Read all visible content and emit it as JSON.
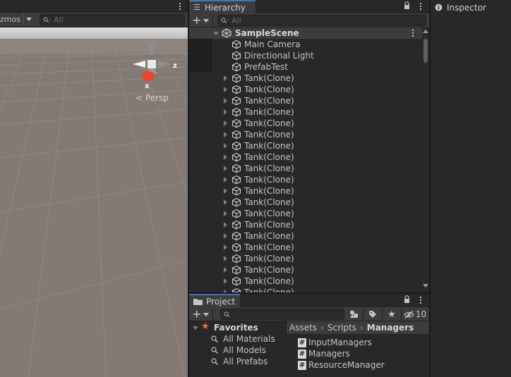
{
  "scene": {
    "toolbar": {
      "gizmos_label": "zmos",
      "search_placeholder": "All"
    },
    "viewport": {
      "persp_label": "Persp",
      "gizmo_axis_x": "x",
      "gizmo_axis_z": "z"
    }
  },
  "hierarchy": {
    "tab_label": "Hierarchy",
    "search_placeholder": "All",
    "scene_name": "SampleScene",
    "items": [
      {
        "label": "Main Camera",
        "has_children": false
      },
      {
        "label": "Directional Light",
        "has_children": false
      },
      {
        "label": "PrefabTest",
        "has_children": false
      },
      {
        "label": "Tank(Clone)",
        "has_children": true
      },
      {
        "label": "Tank(Clone)",
        "has_children": true
      },
      {
        "label": "Tank(Clone)",
        "has_children": true
      },
      {
        "label": "Tank(Clone)",
        "has_children": true
      },
      {
        "label": "Tank(Clone)",
        "has_children": true
      },
      {
        "label": "Tank(Clone)",
        "has_children": true
      },
      {
        "label": "Tank(Clone)",
        "has_children": true
      },
      {
        "label": "Tank(Clone)",
        "has_children": true
      },
      {
        "label": "Tank(Clone)",
        "has_children": true
      },
      {
        "label": "Tank(Clone)",
        "has_children": true
      },
      {
        "label": "Tank(Clone)",
        "has_children": true
      },
      {
        "label": "Tank(Clone)",
        "has_children": true
      },
      {
        "label": "Tank(Clone)",
        "has_children": true
      },
      {
        "label": "Tank(Clone)",
        "has_children": true
      },
      {
        "label": "Tank(Clone)",
        "has_children": true
      },
      {
        "label": "Tank(Clone)",
        "has_children": true
      },
      {
        "label": "Tank(Clone)",
        "has_children": true
      },
      {
        "label": "Tank(Clone)",
        "has_children": true
      },
      {
        "label": "Tank(Clone)",
        "has_children": true
      },
      {
        "label": "Tank(Clone)",
        "has_children": true
      }
    ]
  },
  "project": {
    "tab_label": "Project",
    "hidden_count": "10",
    "favorites": {
      "label": "Favorites",
      "items": [
        "All Materials",
        "All Models",
        "All Prefabs"
      ]
    },
    "breadcrumb": [
      "Assets",
      "Scripts",
      "Managers"
    ],
    "assets": [
      "InputManagers",
      "Managers",
      "ResourceManager"
    ]
  },
  "inspector": {
    "tab_label": "Inspector"
  },
  "colors": {
    "accent_tab": "#3a79bb",
    "panel_bg": "#282828",
    "toolbar_bg": "#3c3c3c",
    "favorite_star": "#e8733a",
    "gizmo_x": "#e8452c"
  },
  "icons": [
    "hierarchy-list-icon",
    "lock-icon",
    "search-icon",
    "unity-scene-icon",
    "gameobject-cube-icon",
    "folder-icon",
    "star-icon",
    "tag-icon",
    "filter-by-type-icon",
    "eye-slash-icon",
    "csharp-script-icon",
    "info-icon",
    "kebab-menu-icon"
  ]
}
